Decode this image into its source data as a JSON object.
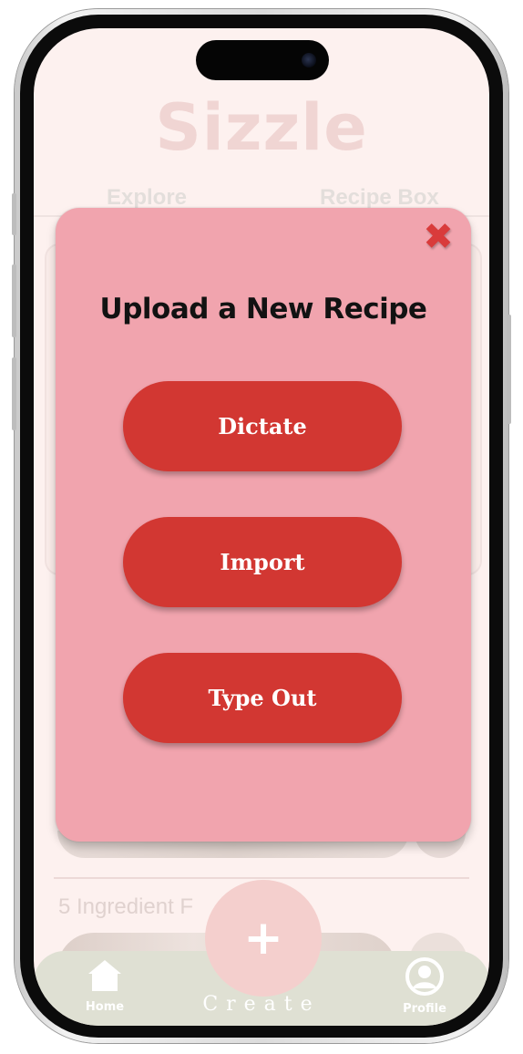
{
  "app": {
    "title": "Sizzle",
    "tabs": [
      "Explore",
      "Recipe Box"
    ],
    "section_title": "5 Ingredient F"
  },
  "modal": {
    "title": "Upload a New Recipe",
    "close_icon": "close-x-icon",
    "buttons": {
      "dictate": "Dictate",
      "import": "Import",
      "type_out": "Type Out"
    }
  },
  "nav": {
    "home": "Home",
    "create": "Create",
    "create_symbol": "+",
    "profile": "Profile"
  },
  "colors": {
    "modal_background": "#f1a4ae",
    "button_red": "#d23732",
    "close_red": "#d93b3b",
    "title_faded": "#f0d5d3",
    "navbar": "#dfe0d3",
    "fab": "#f4cfcd"
  }
}
